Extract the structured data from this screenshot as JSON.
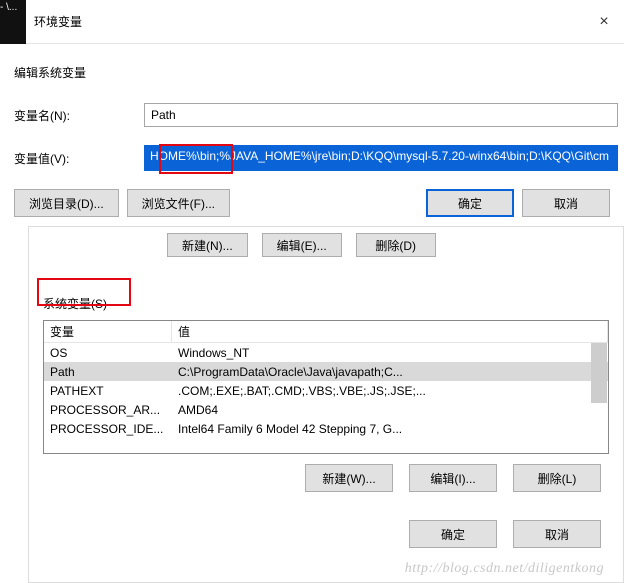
{
  "top": {
    "dark": "- \\...",
    "title": "环境变量",
    "close": "×"
  },
  "edit": {
    "title": "编辑系统变量",
    "name_label": "变量名(N):",
    "name_value": "Path",
    "value_label": "变量值(V):",
    "value_value": "HOME%\\bin;%JAVA_HOME%\\jre\\bin;D:\\KQQ\\mysql-5.7.20-winx64\\bin;D:\\KQQ\\Git\\cm",
    "browse_dir": "浏览目录(D)...",
    "browse_file": "浏览文件(F)...",
    "ok": "确定",
    "cancel": "取消"
  },
  "bg_buttons": {
    "b1": "新建(N)...",
    "b2": "编辑(E)...",
    "b3": "删除(D)"
  },
  "sys": {
    "label": "系统变量(S)",
    "head_var": "变量",
    "head_val": "值",
    "rows": [
      {
        "var": "OS",
        "val": "Windows_NT",
        "sel": false
      },
      {
        "var": "Path",
        "val": "C:\\ProgramData\\Oracle\\Java\\javapath;C...",
        "sel": true
      },
      {
        "var": "PATHEXT",
        "val": ".COM;.EXE;.BAT;.CMD;.VBS;.VBE;.JS;.JSE;...",
        "sel": false
      },
      {
        "var": "PROCESSOR_AR...",
        "val": "AMD64",
        "sel": false
      },
      {
        "var": "PROCESSOR_IDE...",
        "val": "Intel64 Family 6 Model 42 Stepping 7, G...",
        "sel": false
      }
    ],
    "new": "新建(W)...",
    "edit": "编辑(I)...",
    "delete": "删除(L)"
  },
  "panel": {
    "ok": "确定",
    "cancel": "取消"
  },
  "watermark": "http://blog.csdn.net/diligentkong"
}
